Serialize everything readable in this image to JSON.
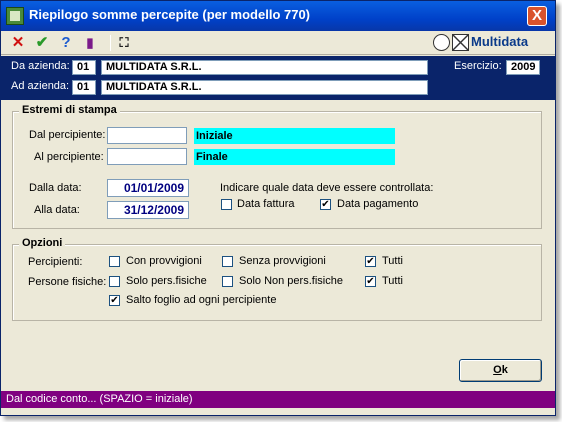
{
  "window": {
    "title": "Riepilogo somme percepite (per modello 770)",
    "close_glyph": "X"
  },
  "toolbar": {
    "cancel_glyph": "✕",
    "confirm_glyph": "✔",
    "help_glyph": "?",
    "book_glyph": "▮",
    "search_glyph": "⛶",
    "brand": "Multidata"
  },
  "header": {
    "da_azienda_label": "Da azienda:",
    "da_azienda_code": "01",
    "da_azienda_name": "MULTIDATA S.R.L.",
    "ad_azienda_label": "Ad azienda:",
    "ad_azienda_code": "01",
    "ad_azienda_name": "MULTIDATA S.R.L.",
    "esercizio_label": "Esercizio:",
    "esercizio_value": "2009"
  },
  "estremi": {
    "legend": "Estremi di stampa",
    "dal_percipiente_label": "Dal percipiente:",
    "dal_percipiente_value": "",
    "dal_percipiente_desc": "Iniziale",
    "al_percipiente_label": "Al percipiente:",
    "al_percipiente_value": "",
    "al_percipiente_desc": "Finale",
    "dalla_data_label": "Dalla data:",
    "dalla_data_value": "01/01/2009",
    "alla_data_label": "Alla data:",
    "alla_data_value": "31/12/2009",
    "control_label": "Indicare quale data deve essere controllata:",
    "data_fattura_label": "Data fattura",
    "data_fattura_checked": false,
    "data_pagamento_label": "Data pagamento",
    "data_pagamento_checked": true
  },
  "opzioni": {
    "legend": "Opzioni",
    "percipienti_label": "Percipienti:",
    "con_provvigioni_label": "Con provvigioni",
    "con_provvigioni_checked": false,
    "senza_provvigioni_label": "Senza provvigioni",
    "senza_provvigioni_checked": false,
    "tutti1_label": "Tutti",
    "tutti1_checked": true,
    "persone_fisiche_label": "Persone fisiche:",
    "solo_pers_fisiche_label": "Solo pers.fisiche",
    "solo_pers_fisiche_checked": false,
    "solo_non_pers_fisiche_label": "Solo Non pers.fisiche",
    "solo_non_pers_fisiche_checked": false,
    "tutti2_label": "Tutti",
    "tutti2_checked": true,
    "salto_foglio_label": "Salto foglio ad ogni percipiente",
    "salto_foglio_checked": true
  },
  "buttons": {
    "ok_accel": "O",
    "ok_rest": "k"
  },
  "status": {
    "text": "Dal codice conto... (SPAZIO = iniziale)"
  },
  "colors": {
    "title_bar": "#0041c9",
    "header_band": "#0a246a",
    "status_bar": "#800080",
    "description_fill": "#00ffff"
  }
}
